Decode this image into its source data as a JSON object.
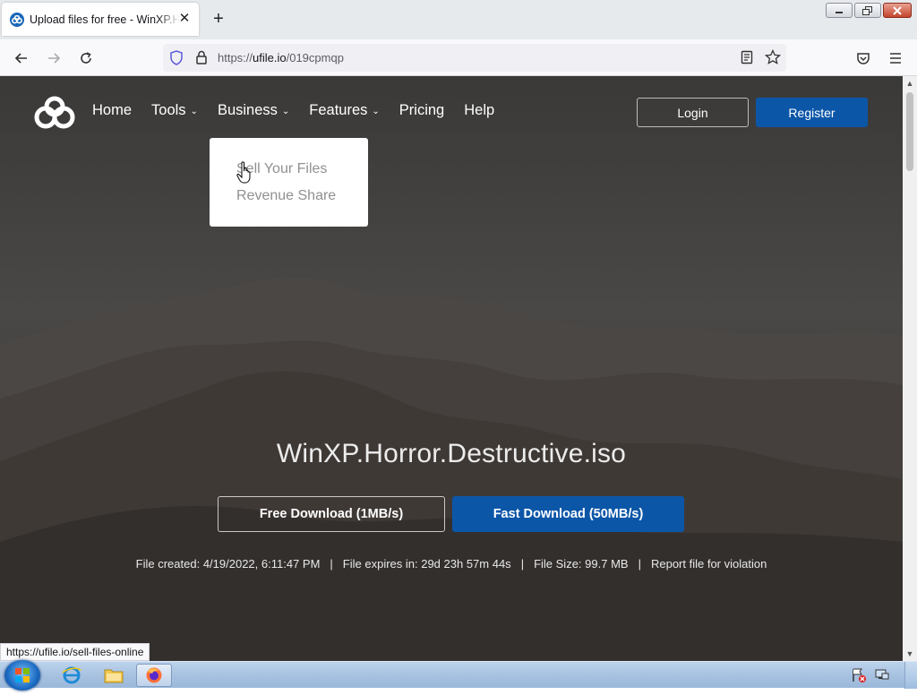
{
  "browser": {
    "tab_title": "Upload files for free - WinXP.Horror.Destructive.iso - ufile.io",
    "new_tab": "+",
    "tab_close": "✕",
    "url_prefix": "https://",
    "url_host": "ufile.io",
    "url_path": "/019cpmqp",
    "status_link": "https://ufile.io/sell-files-online"
  },
  "site": {
    "nav": {
      "home": "Home",
      "tools": "Tools",
      "business": "Business",
      "features": "Features",
      "pricing": "Pricing",
      "help": "Help"
    },
    "caret": "⌄",
    "login": "Login",
    "register": "Register",
    "business_dropdown": [
      "Sell Your Files",
      "Revenue Share"
    ],
    "file_name": "WinXP.Horror.Destructive.iso",
    "free_download": "Free Download (1MB/s)",
    "fast_download": "Fast Download (50MB/s)",
    "file_created": "File created: 4/19/2022, 6:11:47 PM",
    "file_expires": "File expires in: 29d 23h 57m 44s",
    "file_size": "File Size: 99.7 MB",
    "report": "Report file for violation",
    "separator": "|"
  },
  "colors": {
    "accent": "#0c56a8",
    "page_bg": "#3c3b3a"
  }
}
